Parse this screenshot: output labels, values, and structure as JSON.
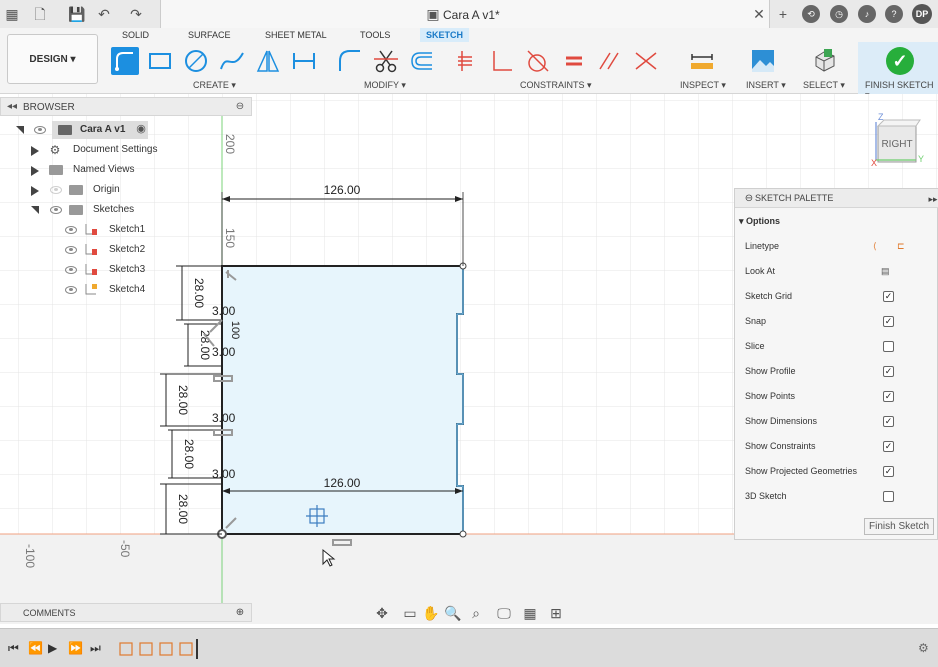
{
  "titlebar": {
    "title": "Cara A v1*",
    "user_initials": "DP"
  },
  "ribbon": {
    "workspace": "DESIGN",
    "tabs": [
      "SOLID",
      "SURFACE",
      "SHEET METAL",
      "TOOLS",
      "SKETCH"
    ],
    "active_tab": "SKETCH",
    "groups": [
      "CREATE",
      "MODIFY",
      "CONSTRAINTS",
      "INSPECT",
      "INSERT",
      "SELECT",
      "FINISH SKETCH"
    ]
  },
  "browser": {
    "title": "BROWSER",
    "root": "Cara A v1",
    "items": [
      "Document Settings",
      "Named Views",
      "Origin",
      "Sketches"
    ],
    "sketches": [
      "Sketch1",
      "Sketch2",
      "Sketch3",
      "Sketch4"
    ]
  },
  "palette": {
    "title": "SKETCH PALETTE",
    "section": "Options",
    "rows": [
      {
        "label": "Linetype",
        "type": "icons"
      },
      {
        "label": "Look At",
        "type": "icon"
      },
      {
        "label": "Sketch Grid",
        "checked": true
      },
      {
        "label": "Snap",
        "checked": true
      },
      {
        "label": "Slice",
        "checked": false
      },
      {
        "label": "Show Profile",
        "checked": true
      },
      {
        "label": "Show Points",
        "checked": true
      },
      {
        "label": "Show Dimensions",
        "checked": true
      },
      {
        "label": "Show Constraints",
        "checked": true
      },
      {
        "label": "Show Projected Geometries",
        "checked": true
      },
      {
        "label": "3D Sketch",
        "checked": false
      }
    ],
    "finish_label": "Finish Sketch"
  },
  "viewcube": {
    "face": "RIGHT",
    "axes": [
      "Z",
      "Y",
      "X"
    ]
  },
  "sketch": {
    "width_dim": "126.00",
    "width_dim_bottom": "126.00",
    "height_dims": [
      "28.00",
      "28.00",
      "28.00",
      "28.00",
      "28.00"
    ],
    "notch_dims": [
      "3.00",
      "3.00",
      "3.00",
      "3.00"
    ],
    "partial_dim": "100",
    "ruler_v": [
      "200",
      "150"
    ],
    "ruler_h": [
      "-100",
      "-50"
    ]
  },
  "comments": {
    "title": "COMMENTS"
  }
}
